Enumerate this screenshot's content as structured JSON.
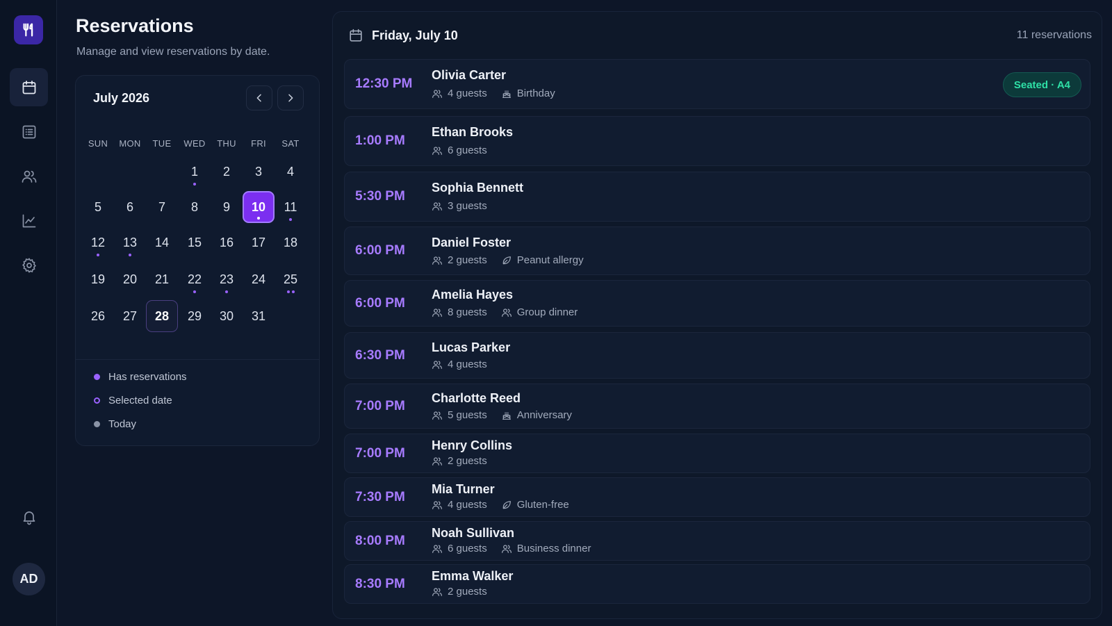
{
  "sidebar": {
    "logo_icon": "utensils-icon",
    "items": [
      {
        "name": "calendar",
        "icon": "calendar-icon",
        "active": true
      },
      {
        "name": "list",
        "icon": "list-icon",
        "active": false
      },
      {
        "name": "guests",
        "icon": "users-icon",
        "active": false
      },
      {
        "name": "analytics",
        "icon": "chart-icon",
        "active": false
      },
      {
        "name": "settings",
        "icon": "gear-icon",
        "active": false
      }
    ],
    "bell_icon": "bell-icon",
    "avatar_initials": "AD"
  },
  "header": {
    "title": "Reservations",
    "subtitle": "Manage and view reservations by date."
  },
  "calendar": {
    "month_label": "July 2026",
    "weekdays": [
      "SUN",
      "MON",
      "TUE",
      "WED",
      "THU",
      "FRI",
      "SAT"
    ],
    "first_weekday_index": 3,
    "days_in_month": 31,
    "selected_day": 10,
    "today_day": 28,
    "reservation_dots": {
      "1": 1,
      "10": 1,
      "11": 1,
      "12": 1,
      "13": 1,
      "22": 1,
      "23": 1,
      "25": 2
    },
    "legend": [
      {
        "label": "Has reservations",
        "kind": "dot",
        "color": "#9a62ff"
      },
      {
        "label": "Selected date",
        "kind": "ring",
        "color": "#9a62ff"
      },
      {
        "label": "Today",
        "kind": "dot",
        "color": "#8a93a6"
      }
    ]
  },
  "panel": {
    "date_label": "Friday, July 10",
    "count_label": "11 reservations"
  },
  "reservations": [
    {
      "time": "12:30 PM",
      "name": "Olivia Carter",
      "guests": "4 guests",
      "note": "Birthday",
      "note_icon": "cake-icon",
      "badge": "Seated · A4"
    },
    {
      "time": "1:00 PM",
      "name": "Ethan Brooks",
      "guests": "6 guests",
      "note": "",
      "note_icon": "",
      "badge": ""
    },
    {
      "time": "5:30 PM",
      "name": "Sophia Bennett",
      "guests": "3 guests",
      "note": "",
      "note_icon": "",
      "badge": ""
    },
    {
      "time": "6:00 PM",
      "name": "Daniel Foster",
      "guests": "2 guests",
      "note": "Peanut allergy",
      "note_icon": "leaf-icon",
      "badge": ""
    },
    {
      "time": "6:00 PM",
      "name": "Amelia Hayes",
      "guests": "8 guests",
      "note": "Group dinner",
      "note_icon": "users-icon",
      "badge": ""
    },
    {
      "time": "6:30 PM",
      "name": "Lucas Parker",
      "guests": "4 guests",
      "note": "",
      "note_icon": "",
      "badge": ""
    },
    {
      "time": "7:00 PM",
      "name": "Charlotte Reed",
      "guests": "5 guests",
      "note": "Anniversary",
      "note_icon": "cake-icon",
      "badge": ""
    },
    {
      "time": "7:00 PM",
      "name": "Henry Collins",
      "guests": "2 guests",
      "note": "",
      "note_icon": "",
      "badge": ""
    },
    {
      "time": "7:30 PM",
      "name": "Mia Turner",
      "guests": "4 guests",
      "note": "Gluten-free",
      "note_icon": "leaf-icon",
      "badge": ""
    },
    {
      "time": "8:00 PM",
      "name": "Noah Sullivan",
      "guests": "6 guests",
      "note": "Business dinner",
      "note_icon": "users-icon",
      "badge": ""
    },
    {
      "time": "8:30 PM",
      "name": "Emma Walker",
      "guests": "2 guests",
      "note": "",
      "note_icon": "",
      "badge": ""
    }
  ],
  "colors": {
    "accent": "#7b2ff0",
    "time_text": "#a77bff",
    "seated_badge": "#2ee0a6"
  }
}
